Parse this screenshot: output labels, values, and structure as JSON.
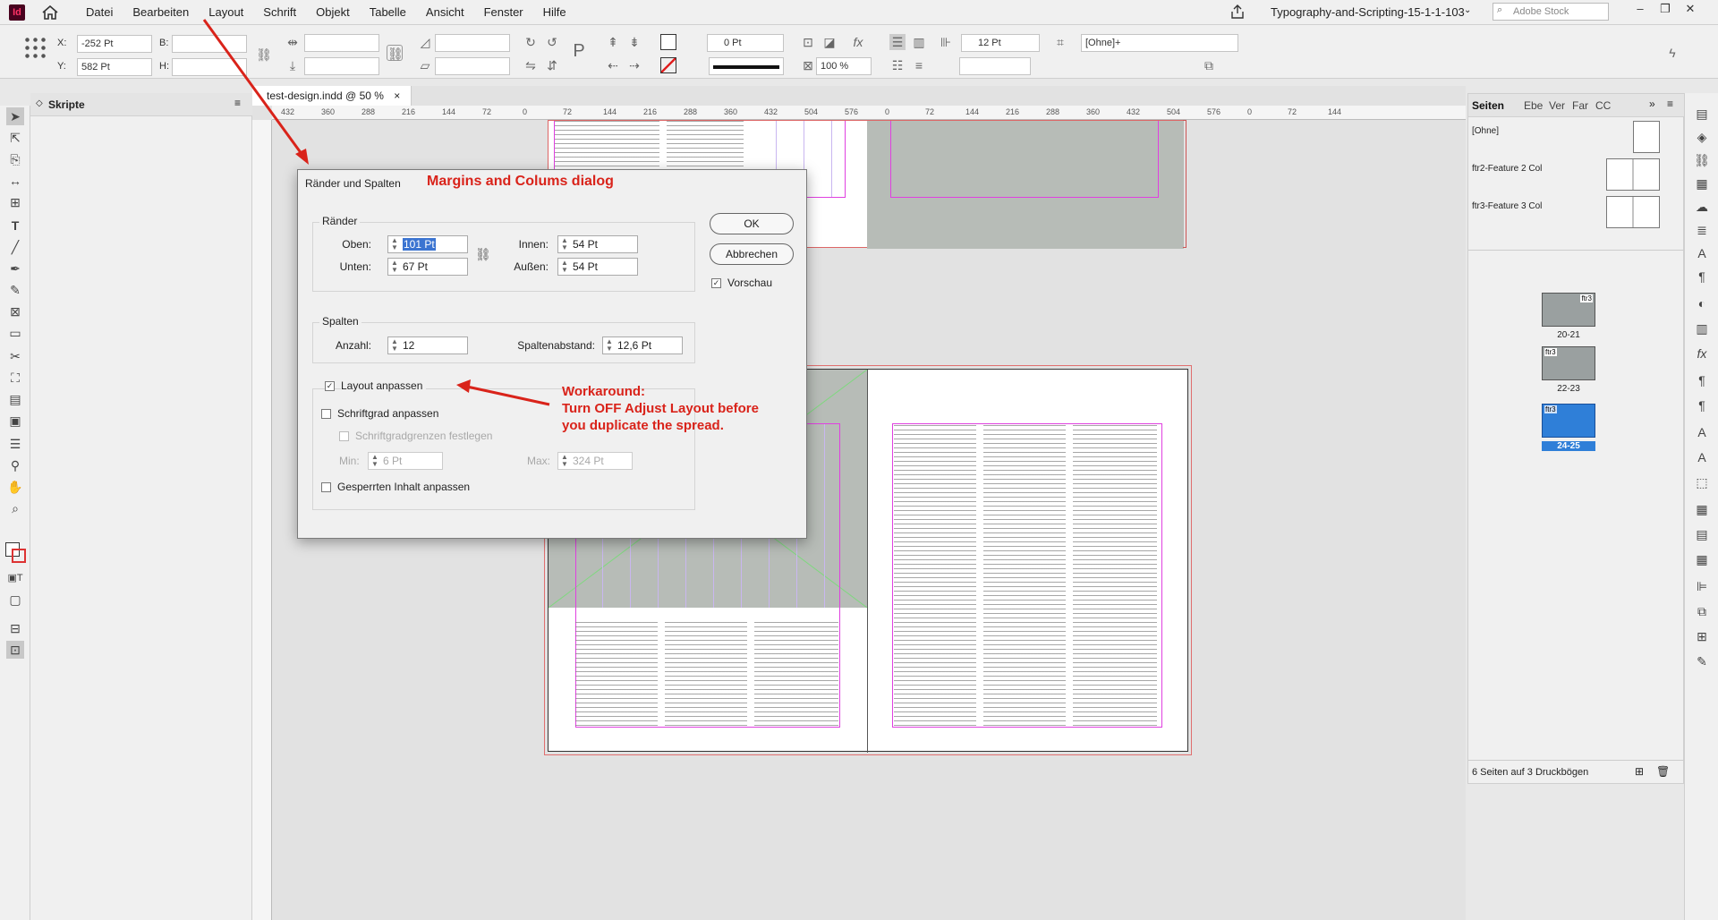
{
  "app": {
    "logo": "Id",
    "doc_title": "Typography-and-Scripting-15-1-1-103",
    "search_placeholder": "Adobe Stock"
  },
  "menu": [
    "Datei",
    "Bearbeiten",
    "Layout",
    "Schrift",
    "Objekt",
    "Tabelle",
    "Ansicht",
    "Fenster",
    "Hilfe"
  ],
  "controlbar": {
    "x_label": "X:",
    "x_value": "-252 Pt",
    "y_label": "Y:",
    "y_value": "582 Pt",
    "b_label": "B:",
    "h_label": "H:",
    "stroke_value": "0 Pt",
    "zoom_value": "100 %",
    "gutter_value": "12 Pt",
    "style_value": "[Ohne]+"
  },
  "left_panel": {
    "title": "Skripte"
  },
  "doc_tab": {
    "label": "test-design.indd @ 50 %",
    "close": "×"
  },
  "ruler_ticks": [
    "432",
    "360",
    "288",
    "216",
    "144",
    "72",
    "0",
    "72",
    "144",
    "216",
    "288",
    "360",
    "432",
    "504",
    "576",
    "0",
    "72",
    "144",
    "216",
    "288",
    "360",
    "432",
    "504",
    "576",
    "0",
    "72",
    "144"
  ],
  "dialog": {
    "title": "Ränder und Spalten",
    "margins_group": "Ränder",
    "oben_label": "Oben:",
    "oben_value": "101 Pt",
    "unten_label": "Unten:",
    "unten_value": "67 Pt",
    "innen_label": "Innen:",
    "innen_value": "54 Pt",
    "aussen_label": "Außen:",
    "aussen_value": "54 Pt",
    "columns_group": "Spalten",
    "anzahl_label": "Anzahl:",
    "anzahl_value": "12",
    "gap_label": "Spaltenabstand:",
    "gap_value": "12,6 Pt",
    "layout_adjust": "Layout anpassen",
    "font_adjust": "Schriftgrad anpassen",
    "font_limits": "Schriftgradgrenzen festlegen",
    "min_label": "Min:",
    "min_value": "6 Pt",
    "max_label": "Max:",
    "max_value": "324 Pt",
    "locked_adjust": "Gesperrten Inhalt anpassen",
    "ok": "OK",
    "cancel": "Abbrechen",
    "preview": "Vorschau"
  },
  "annotations": {
    "dialog_note": "Margins and Colums dialog",
    "workaround_1": "Workaround:",
    "workaround_2": "Turn OFF Adjust Layout before",
    "workaround_3": "you duplicate the spread."
  },
  "pages_panel": {
    "tabs": [
      "Seiten",
      "Ebe",
      "Ver",
      "Far",
      "CC"
    ],
    "masters": [
      "[Ohne]",
      "ftr2-Feature 2 Col",
      "ftr3-Feature 3 Col"
    ],
    "spreads": [
      {
        "label": "20-21",
        "tag": "ftr3"
      },
      {
        "label": "22-23",
        "tag": "ftr3"
      },
      {
        "label": "24-25",
        "tag": "ftr3"
      }
    ],
    "footer": "6 Seiten auf 3 Druckbögen"
  },
  "colors": {
    "annotation_red": "#d9231a",
    "selected_spread": "#2f7fd8",
    "guide_magenta": "#e040e0"
  }
}
